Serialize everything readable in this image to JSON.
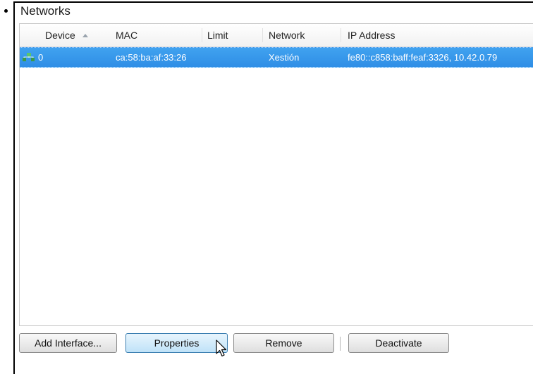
{
  "section": {
    "title": "Networks"
  },
  "table": {
    "columns": [
      "Device",
      "MAC",
      "Limit",
      "Network",
      "IP Address"
    ],
    "sorted_column": "Device",
    "sort_direction": "ascending",
    "rows": [
      {
        "device": "0",
        "mac": "ca:58:ba:af:33:26",
        "limit": "",
        "network": "Xestión",
        "ip": "fe80::c858:baff:feaf:3326, 10.42.0.79",
        "selected": true
      }
    ]
  },
  "buttons": {
    "add_interface": "Add Interface...",
    "properties": "Properties",
    "remove": "Remove",
    "deactivate": "Deactivate"
  },
  "colors": {
    "selection": "#3a99ec",
    "button_active": "#bfe2f8"
  },
  "icons": {
    "row_icon": "network-interface-icon",
    "cursor": "mouse-pointer-icon"
  }
}
